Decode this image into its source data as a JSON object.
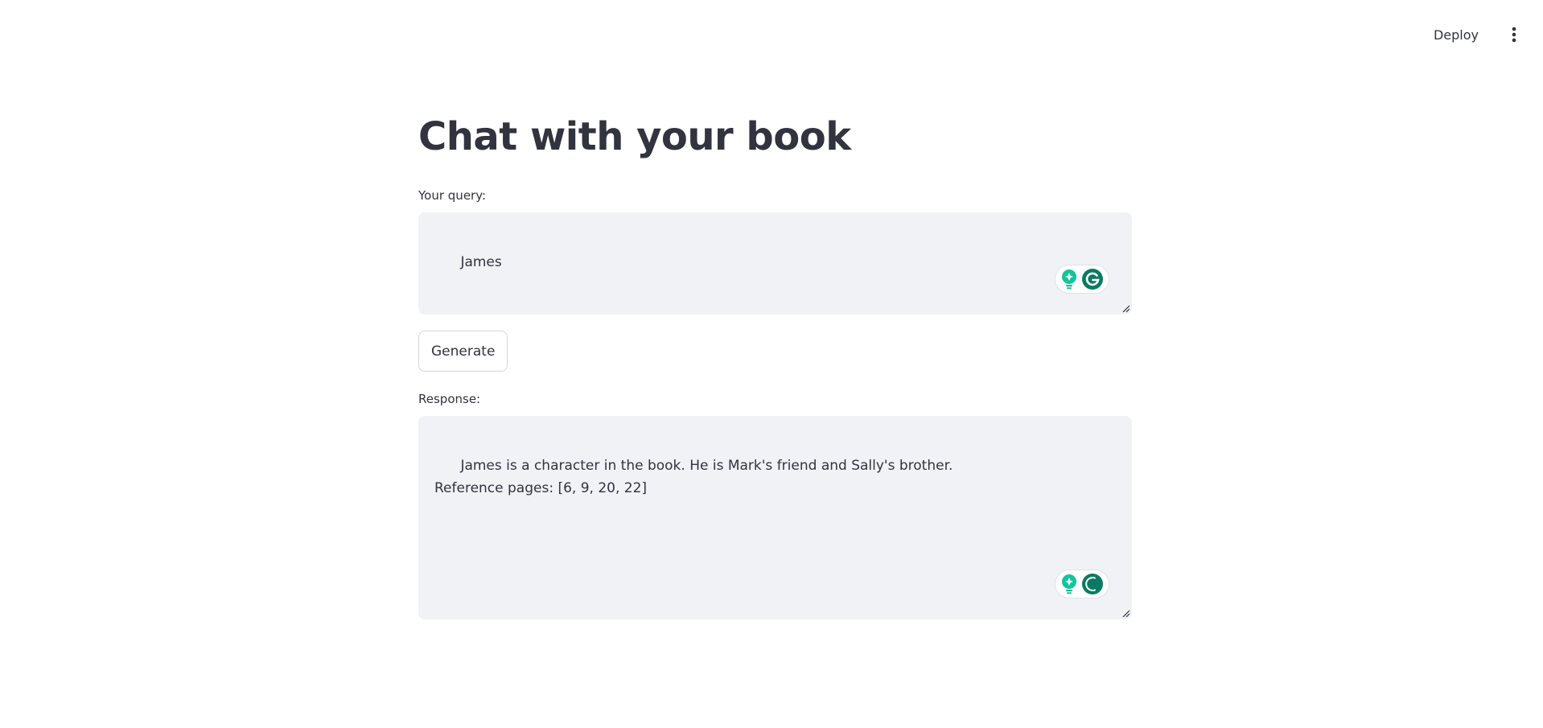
{
  "toolbar": {
    "deploy_label": "Deploy",
    "menu_icon": "vertical-dots-icon"
  },
  "page": {
    "title": "Chat with your book"
  },
  "query": {
    "label": "Your query:",
    "value": "James"
  },
  "generate": {
    "label": "Generate"
  },
  "response": {
    "label": "Response:",
    "value": "James is a character in the book. He is Mark's friend and Sally's brother.\nReference pages: [6, 9, 20, 22]"
  },
  "colors": {
    "text": "#31333f",
    "field_bg": "#f0f2f6",
    "grammarly_green": "#15c39a",
    "grammarly_dark": "#0a7a63"
  }
}
